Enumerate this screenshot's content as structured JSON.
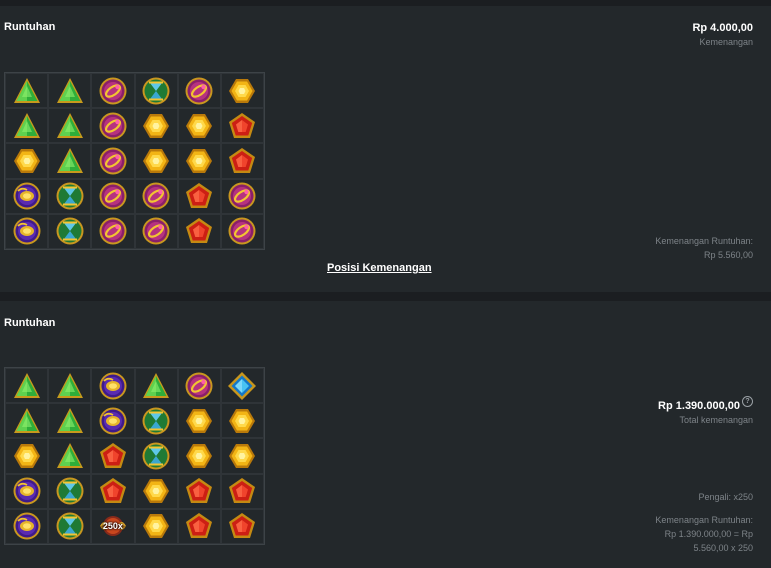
{
  "panel1": {
    "title": "Runtuhan",
    "win_amount": "Rp 4.000,00",
    "win_label": "Kemenangan",
    "cascade_label": "Kemenangan Runtuhan:",
    "cascade_value": "Rp 5.560,00",
    "link": "Posisi Kemenangan",
    "grid": [
      [
        "green-triangle",
        "green-triangle",
        "purple-ring",
        "teal-hourglass",
        "purple-ring",
        "gold-hexagon"
      ],
      [
        "green-triangle",
        "green-triangle",
        "purple-ring",
        "gold-hexagon",
        "gold-hexagon",
        "red-pentagon"
      ],
      [
        "gold-hexagon",
        "green-triangle",
        "purple-ring",
        "gold-hexagon",
        "gold-hexagon",
        "red-pentagon"
      ],
      [
        "purple-scarab",
        "teal-hourglass",
        "purple-ring",
        "purple-ring",
        "red-pentagon",
        "purple-ring"
      ],
      [
        "purple-scarab",
        "teal-hourglass",
        "purple-ring",
        "purple-ring",
        "red-pentagon",
        "purple-ring"
      ]
    ]
  },
  "panel2": {
    "title": "Runtuhan",
    "total_amount": "Rp 1.390.000,00",
    "help_icon": "?",
    "total_label": "Total kemenangan",
    "multiplier_line": "Pengali: x250",
    "cascade_label": "Kemenangan Runtuhan:",
    "cascade_line1": "Rp 1.390.000,00 = Rp",
    "cascade_line2": "5.560,00 x 250",
    "multiplier_badge": "250x",
    "grid": [
      [
        "green-triangle",
        "green-triangle",
        "purple-scarab",
        "green-triangle",
        "purple-ring",
        "blue-diamond"
      ],
      [
        "green-triangle",
        "green-triangle",
        "purple-scarab",
        "teal-hourglass",
        "gold-hexagon",
        "gold-hexagon"
      ],
      [
        "gold-hexagon",
        "green-triangle",
        "red-pentagon",
        "teal-hourglass",
        "gold-hexagon",
        "gold-hexagon"
      ],
      [
        "purple-scarab",
        "teal-hourglass",
        "red-pentagon",
        "gold-hexagon",
        "red-pentagon",
        "red-pentagon"
      ],
      [
        "purple-scarab",
        "teal-hourglass",
        "multiplier-orb",
        "gold-hexagon",
        "red-pentagon",
        "red-pentagon"
      ]
    ]
  },
  "colors": {
    "background": "#1b1e21",
    "panel": "#23282b",
    "muted_text": "#7d8388"
  }
}
